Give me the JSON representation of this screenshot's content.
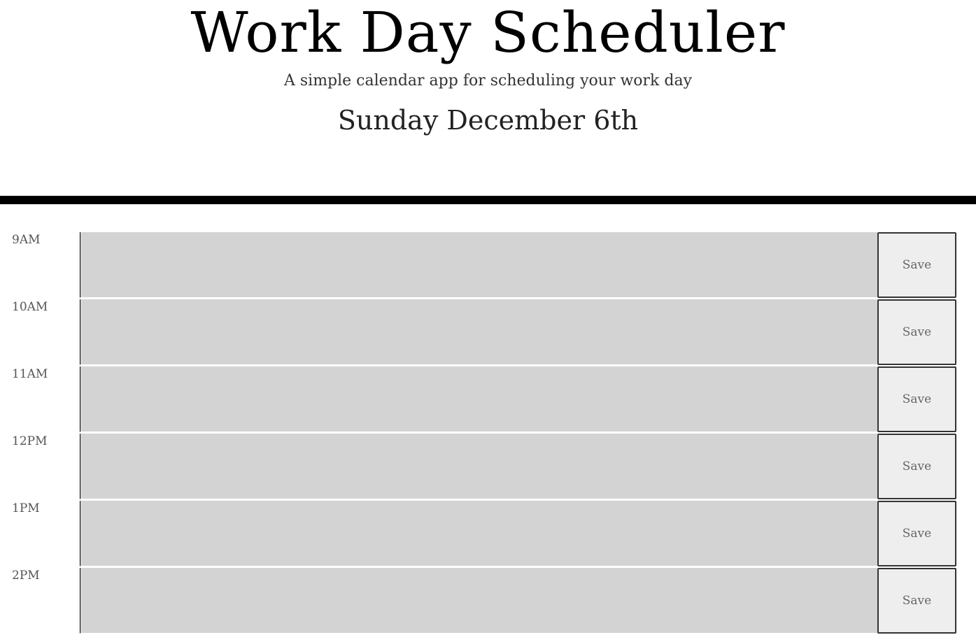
{
  "header": {
    "title": "Work Day Scheduler",
    "lead": "A simple calendar app for scheduling your work day",
    "current_day": "Sunday December 6th"
  },
  "time_blocks": [
    {
      "hour": "9AM",
      "text": "",
      "save_label": "Save"
    },
    {
      "hour": "10AM",
      "text": "",
      "save_label": "Save"
    },
    {
      "hour": "11AM",
      "text": "",
      "save_label": "Save"
    },
    {
      "hour": "12PM",
      "text": "",
      "save_label": "Save"
    },
    {
      "hour": "1PM",
      "text": "",
      "save_label": "Save"
    },
    {
      "hour": "2PM",
      "text": "",
      "save_label": "Save"
    }
  ],
  "colors": {
    "past_block": "#d3d3d3",
    "save_button": "#eeeeee",
    "divider": "#000000"
  }
}
